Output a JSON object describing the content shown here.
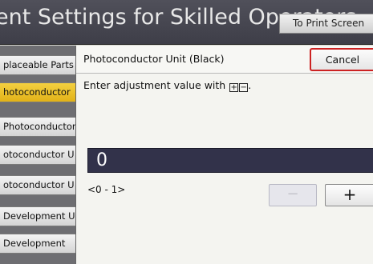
{
  "header": {
    "title": "ent Settings for Skilled Operators",
    "print_button": "To Print Screen"
  },
  "left_list": {
    "items": [
      {
        "label": "placeable Parts",
        "selected": false
      },
      {
        "label": "hotoconductor",
        "selected": true
      },
      {
        "label": "Photoconductor",
        "selected": false
      },
      {
        "label": "otoconductor U",
        "selected": false
      },
      {
        "label": "otoconductor U",
        "selected": false
      },
      {
        "label": "Development U",
        "selected": false
      },
      {
        "label": "Development",
        "selected": false
      }
    ]
  },
  "dialog": {
    "title": "Photoconductor Unit (Black)",
    "cancel_label": "Cancel",
    "instruction_prefix": "Enter adjustment value with ",
    "instruction_suffix": ".",
    "plus_key_glyph": "+",
    "minus_key_glyph": "−",
    "value": "0",
    "range": "<0 - 1>",
    "minus_label": "−",
    "plus_label": "+"
  },
  "colors": {
    "header_bg": "#45454f",
    "selected_item": "#ecc22a",
    "value_box_bg": "#32324a",
    "cancel_border": "#cc2222"
  }
}
